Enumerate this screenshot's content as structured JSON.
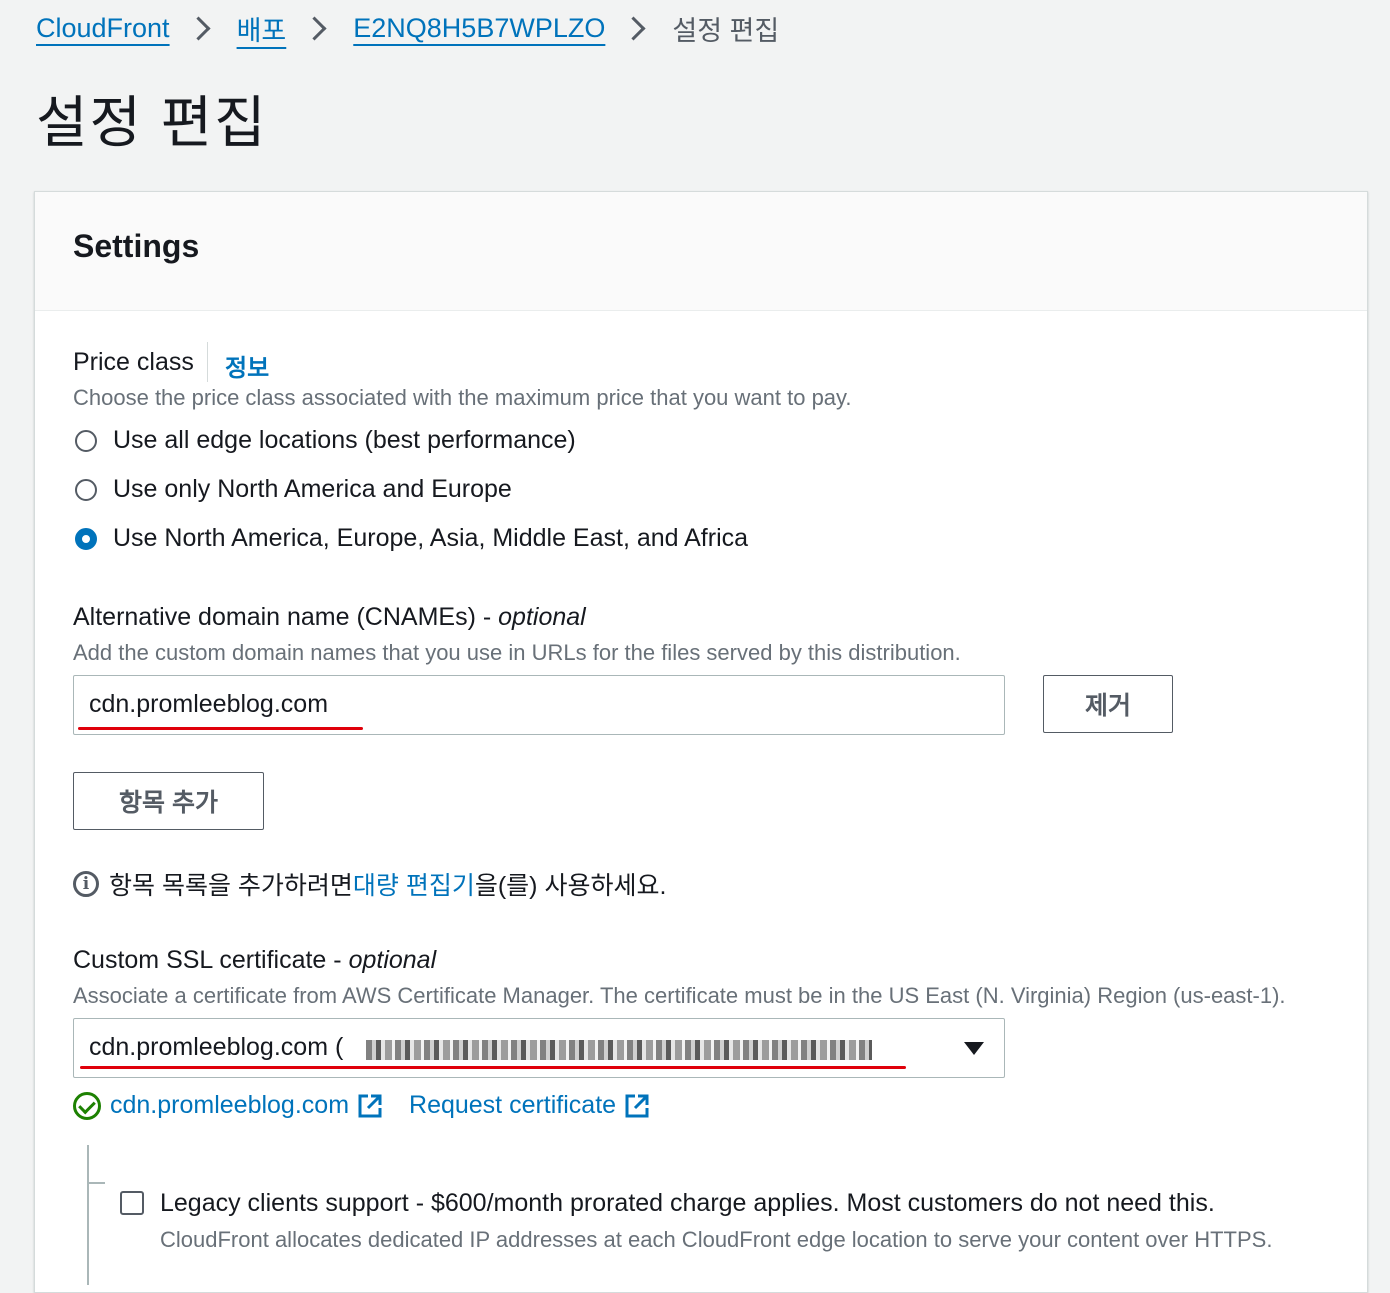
{
  "breadcrumb": {
    "items": [
      "CloudFront",
      "배포",
      "E2NQ8H5B7WPLZO"
    ],
    "current": "설정 편집"
  },
  "page_title": "설정 편집",
  "settings": {
    "title": "Settings",
    "price_class": {
      "label": "Price class",
      "info": "정보",
      "description": "Choose the price class associated with the maximum price that you want to pay.",
      "options": [
        "Use all edge locations (best performance)",
        "Use only North America and Europe",
        "Use North America, Europe, Asia, Middle East, and Africa"
      ],
      "selected_index": 2
    },
    "cname": {
      "label": "Alternative domain name (CNAMEs) - ",
      "optional": "optional",
      "description": "Add the custom domain names that you use in URLs for the files served by this distribution.",
      "value": "cdn.promleeblog.com",
      "remove_label": "제거",
      "add_label": "항목 추가",
      "bulk_prefix": "항목 목록을 추가하려면 ",
      "bulk_link": "대량 편집기",
      "bulk_suffix": "을(를) 사용하세요."
    },
    "ssl": {
      "label": "Custom SSL certificate - ",
      "optional": "optional",
      "description": "Associate a certificate from AWS Certificate Manager. The certificate must be in the US East (N. Virginia) Region (us-east-1).",
      "selected": "cdn.promleeblog.com",
      "selected_paren": "(",
      "validated_link": "cdn.promleeblog.com",
      "request_link": "Request certificate"
    },
    "legacy": {
      "label": "Legacy clients support - $600/month prorated charge applies. Most customers do not need this.",
      "description": "CloudFront allocates dedicated IP addresses at each CloudFront edge location to serve your content over HTTPS."
    }
  },
  "colors": {
    "link": "#0073bb",
    "success": "#1d8102",
    "annotation_underline": "#e0000a"
  }
}
